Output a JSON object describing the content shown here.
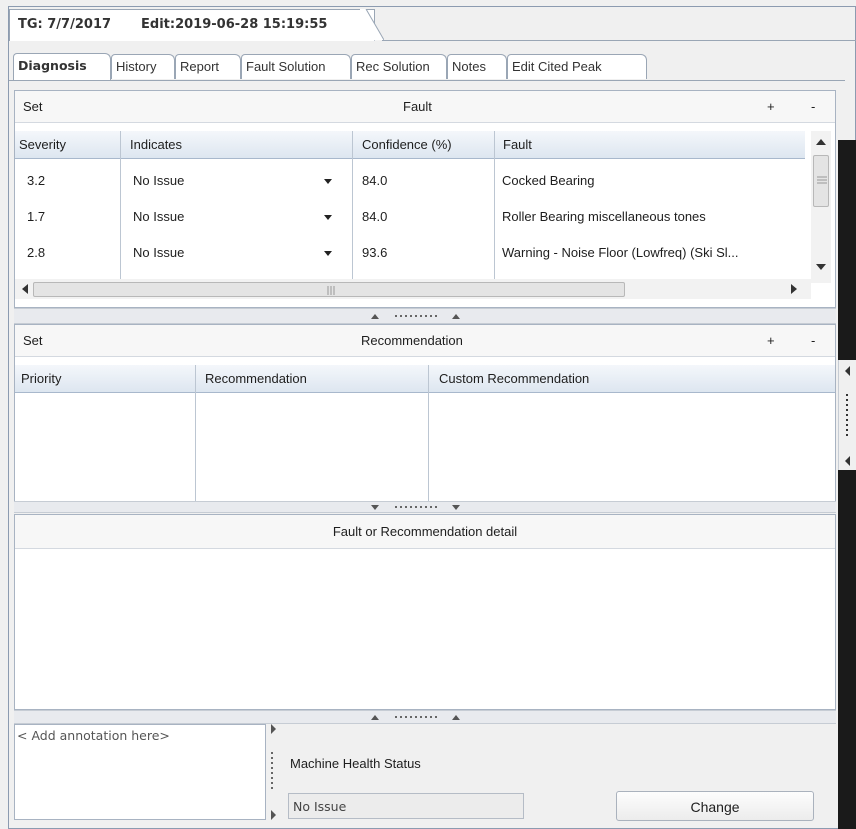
{
  "document_tab": {
    "tg_label": "TG: 7/7/2017",
    "edit_label": "Edit:2019-06-28 15:19:55"
  },
  "tabs": [
    {
      "label": "Diagnosis",
      "active": true
    },
    {
      "label": "History"
    },
    {
      "label": "Report"
    },
    {
      "label": "Fault Solution"
    },
    {
      "label": "Rec Solution"
    },
    {
      "label": "Notes"
    },
    {
      "label": "Edit Cited Peak"
    }
  ],
  "fault_section": {
    "set_label": "Set",
    "title": "Fault",
    "add_label": "+",
    "remove_label": "-",
    "columns": [
      "Severity",
      "Indicates",
      "Confidence (%)",
      "Fault"
    ],
    "rows": [
      {
        "severity": "3.2",
        "indicates": "No Issue",
        "confidence": "84.0",
        "fault": "Cocked Bearing"
      },
      {
        "severity": "1.7",
        "indicates": "No Issue",
        "confidence": "84.0",
        "fault": "Roller Bearing miscellaneous tones"
      },
      {
        "severity": "2.8",
        "indicates": "No Issue",
        "confidence": "93.6",
        "fault": "Warning - Noise Floor (Lowfreq) (Ski Sl..."
      }
    ]
  },
  "recommendation_section": {
    "set_label": "Set",
    "title": "Recommendation",
    "add_label": "+",
    "remove_label": "-",
    "columns": [
      "Priority",
      "Recommendation",
      "Custom Recommendation"
    ]
  },
  "detail_section": {
    "title": "Fault or Recommendation detail"
  },
  "annotation": {
    "placeholder": "< Add annotation here>"
  },
  "machine_health": {
    "label": "Machine Health Status",
    "value": "No Issue",
    "change_label": "Change"
  }
}
